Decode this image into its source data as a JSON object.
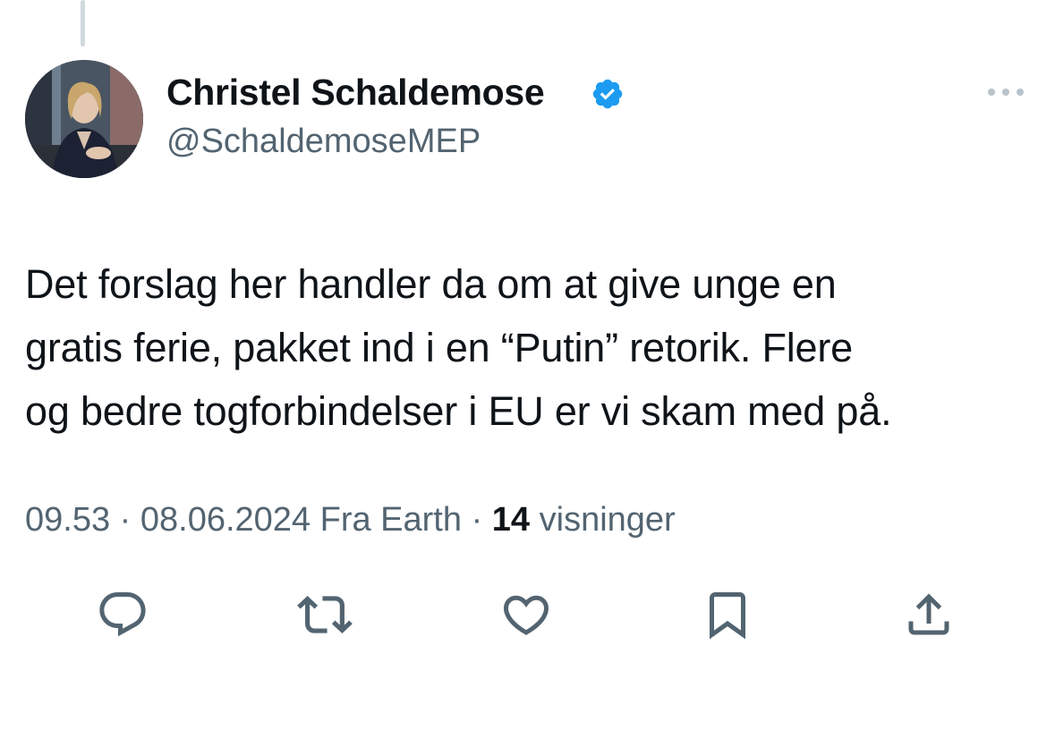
{
  "author": {
    "display_name": "Christel Schaldemose",
    "handle": "@SchaldemoseMEP",
    "verified": true,
    "avatar_icon": "profile-photo"
  },
  "tweet": {
    "lines": [
      "Det forslag her handler da om at give unge en",
      "gratis ferie, pakket ind i en “Putin” retorik. Flere",
      "og bedre togforbindelser i EU er vi skam med på."
    ]
  },
  "meta": {
    "time": "09.53",
    "separator1": " · ",
    "date": "08.06.2024",
    "source": " Fra Earth",
    "separator2": " · ",
    "views_count": "14",
    "views_label": " visninger"
  },
  "actions": [
    {
      "icon": "reply-icon"
    },
    {
      "icon": "retweet-icon"
    },
    {
      "icon": "like-icon"
    },
    {
      "icon": "bookmark-icon"
    },
    {
      "icon": "share-icon"
    }
  ],
  "colors": {
    "text": "#0f1419",
    "secondary": "#536471",
    "verified_blue": "#1d9bf0",
    "thread_line": "#cfd9de"
  }
}
